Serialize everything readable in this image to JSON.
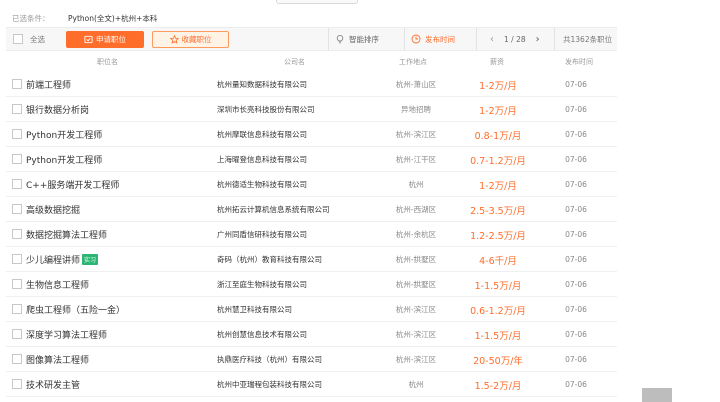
{
  "filters": {
    "label": "已选条件：",
    "value": "Python(全文)+杭州+本科"
  },
  "toolbar": {
    "select_all": "全选",
    "apply": "申请职位",
    "favorite": "收藏职位",
    "smart_sort": "智能排序",
    "time_sort": "发布时间",
    "page": "1 / 28",
    "total": "共1362条职位"
  },
  "columns": {
    "title": "职位名",
    "company": "公司名",
    "location": "工作地点",
    "salary": "薪资",
    "date": "发布时间"
  },
  "jobs": [
    {
      "title": "前端工程师",
      "company": "杭州量知数据科技有限公司",
      "location": "杭州-萧山区",
      "salary": "1-2万/月",
      "date": "07-06"
    },
    {
      "title": "银行数据分析岗",
      "company": "深圳市长亮科技股份有限公司",
      "location": "异地招聘",
      "salary": "1-2万/月",
      "date": "07-06"
    },
    {
      "title": "Python开发工程师",
      "company": "杭州摩联信息科技有限公司",
      "location": "杭州-滨江区",
      "salary": "0.8-1万/月",
      "date": "07-06"
    },
    {
      "title": "Python开发工程师",
      "company": "上海曜登信息科技有限公司",
      "location": "杭州-江干区",
      "salary": "0.7-1.2万/月",
      "date": "07-06"
    },
    {
      "title": "C++服务端开发工程师",
      "company": "杭州德适生物科技有限公司",
      "location": "杭州",
      "salary": "1-2万/月",
      "date": "07-06"
    },
    {
      "title": "高级数据挖掘",
      "company": "杭州拓云计算机信息系统有限公司",
      "location": "杭州-西湖区",
      "salary": "2.5-3.5万/月",
      "date": "07-06"
    },
    {
      "title": "数据挖掘算法工程师",
      "company": "广州同盾信研科技有限公司",
      "location": "杭州-余杭区",
      "salary": "1.2-2.5万/月",
      "date": "07-06"
    },
    {
      "title": "少儿编程讲师",
      "tag": "实习",
      "company": "奇码（杭州）教育科技有限公司",
      "location": "杭州-拱墅区",
      "salary": "4-6千/月",
      "date": "07-06"
    },
    {
      "title": "生物信息工程师",
      "company": "浙江至庭生物科技有限公司",
      "location": "杭州-拱墅区",
      "salary": "1-1.5万/月",
      "date": "07-06"
    },
    {
      "title": "爬虫工程师（五险一金）",
      "company": "杭州慧卫科技有限公司",
      "location": "杭州-滨江区",
      "salary": "0.6-1.2万/月",
      "date": "07-06"
    },
    {
      "title": "深度学习算法工程师",
      "company": "杭州创慧信息技术有限公司",
      "location": "杭州-滨江区",
      "salary": "1-1.5万/月",
      "date": "07-06"
    },
    {
      "title": "图像算法工程师",
      "company": "执鼎医疗科技（杭州）有限公司",
      "location": "杭州-滨江区",
      "salary": "20-50万/年",
      "date": "07-06"
    },
    {
      "title": "技术研发主管",
      "company": "杭州中亚瑞程包装科技有限公司",
      "location": "杭州",
      "salary": "1.5-2万/月",
      "date": "07-06"
    }
  ],
  "colors": {
    "accent": "#ff6d2a",
    "intern_tag": "#2bb673"
  },
  "scroll_top_icon": "arrow-up-icon"
}
